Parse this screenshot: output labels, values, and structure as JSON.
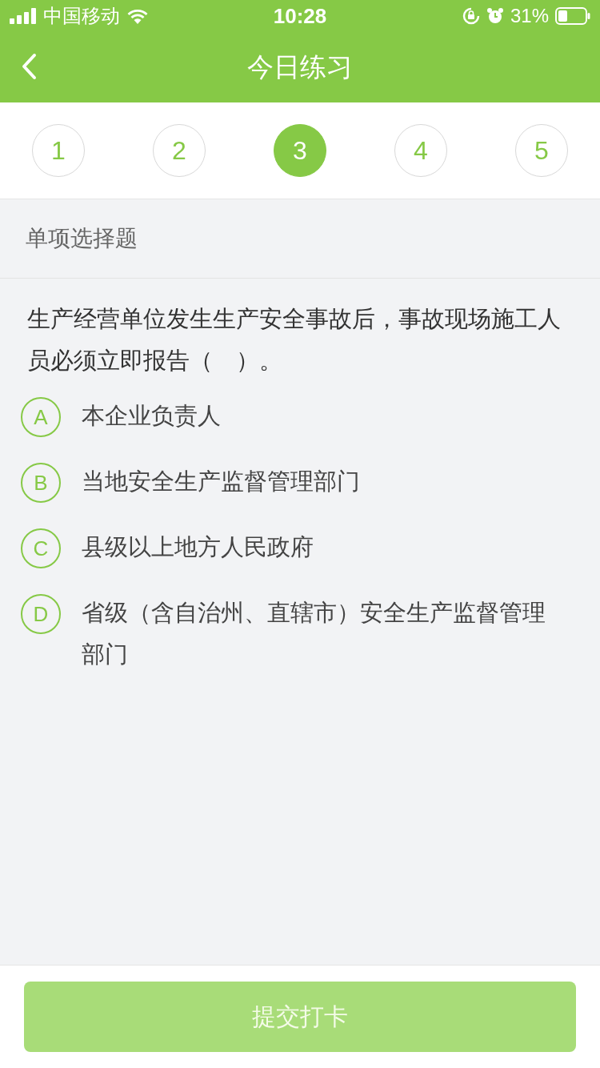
{
  "status_bar": {
    "carrier": "中国移动",
    "time": "10:28",
    "battery": "31%"
  },
  "nav": {
    "title": "今日练习"
  },
  "steps": [
    {
      "label": "1",
      "selected": false
    },
    {
      "label": "2",
      "selected": false
    },
    {
      "label": "3",
      "selected": true
    },
    {
      "label": "4",
      "selected": false
    },
    {
      "label": "5",
      "selected": false
    }
  ],
  "question_type": "单项选择题",
  "question": "生产经营单位发生生产安全事故后，事故现场施工人员必须立即报告（　）。",
  "options": [
    {
      "letter": "A",
      "text": "本企业负责人",
      "selected": false
    },
    {
      "letter": "B",
      "text": "当地安全生产监督管理部门",
      "selected": false
    },
    {
      "letter": "C",
      "text": "县级以上地方人民政府",
      "selected": false
    },
    {
      "letter": "D",
      "text": "省级（含自治州、直辖市）安全生产监督管理部门",
      "selected": false
    }
  ],
  "submit": {
    "label": "提交打卡",
    "disabled": true
  }
}
